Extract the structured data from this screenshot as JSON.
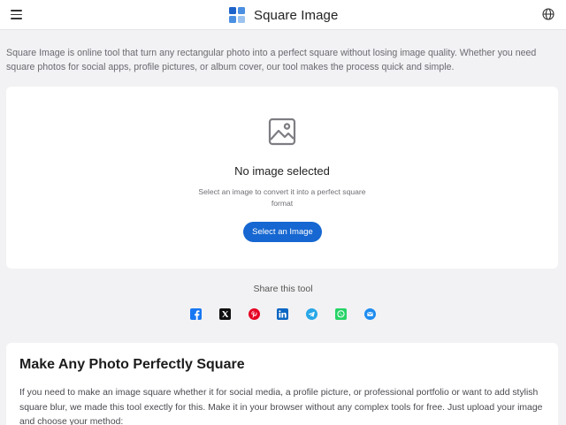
{
  "header": {
    "title": "Square Image",
    "menu_icon": "hamburger-menu-icon",
    "language_icon": "globe-icon"
  },
  "intro": {
    "text": "Square Image is online tool that turn any rectangular photo into a perfect square without losing image quality. Whether you need square photos for social apps, profile pictures, or album cover, our tool makes the process quick and simple."
  },
  "upload": {
    "icon": "image-placeholder-icon",
    "status": "No image selected",
    "helper": "Select an image to convert it into a perfect square format",
    "button_label": "Select an Image"
  },
  "share": {
    "title": "Share this tool",
    "buttons": [
      {
        "name": "facebook",
        "icon": "facebook-icon",
        "color": "#1877f2"
      },
      {
        "name": "x",
        "icon": "x-icon",
        "color": "#111111"
      },
      {
        "name": "pinterest",
        "icon": "pinterest-icon",
        "color": "#e60023"
      },
      {
        "name": "linkedin",
        "icon": "linkedin-icon",
        "color": "#0a66c2"
      },
      {
        "name": "telegram",
        "icon": "telegram-icon",
        "color": "#27a7e7"
      },
      {
        "name": "whatsapp",
        "icon": "whatsapp-icon",
        "color": "#25d366"
      },
      {
        "name": "email",
        "icon": "email-icon",
        "color": "#1e8cf0"
      }
    ]
  },
  "content": {
    "heading": "Make Any Photo Perfectly Square",
    "paragraph": "If you need to make an image square whether it for social media, a profile picture, or professional portfolio or want to add stylish square blur, we made this tool exectly for this. Make it in your browser without any complex tools for free. Just upload your image and choose your method:"
  },
  "colors": {
    "accent": "#1667d1",
    "background": "#f2f2f4",
    "card": "#ffffff"
  }
}
